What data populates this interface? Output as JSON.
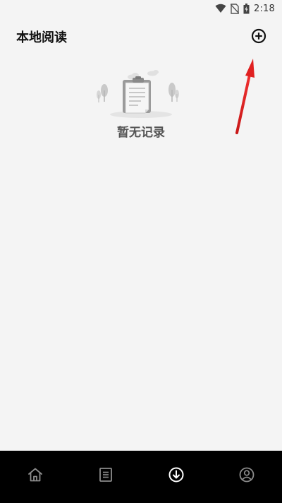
{
  "status_bar": {
    "time": "2:18",
    "icons": [
      "wifi-icon",
      "no-sim-icon",
      "battery-icon"
    ]
  },
  "header": {
    "title": "本地阅读",
    "action_icon": "add-circle-icon"
  },
  "empty_state": {
    "message": "暂无记录",
    "illustration": "empty-clipboard-icon"
  },
  "annotation": {
    "icon": "red-arrow",
    "color": "#e02020"
  },
  "bottom_nav": {
    "items": [
      {
        "icon": "home-icon",
        "active": false
      },
      {
        "icon": "list-icon",
        "active": false
      },
      {
        "icon": "download-icon",
        "active": true
      },
      {
        "icon": "profile-icon",
        "active": false
      }
    ]
  },
  "colors": {
    "background": "#f4f4f4",
    "nav_background": "#000000",
    "nav_icon": "#8c8c8c",
    "nav_icon_active": "#ffffff",
    "accent": "#e02020"
  }
}
